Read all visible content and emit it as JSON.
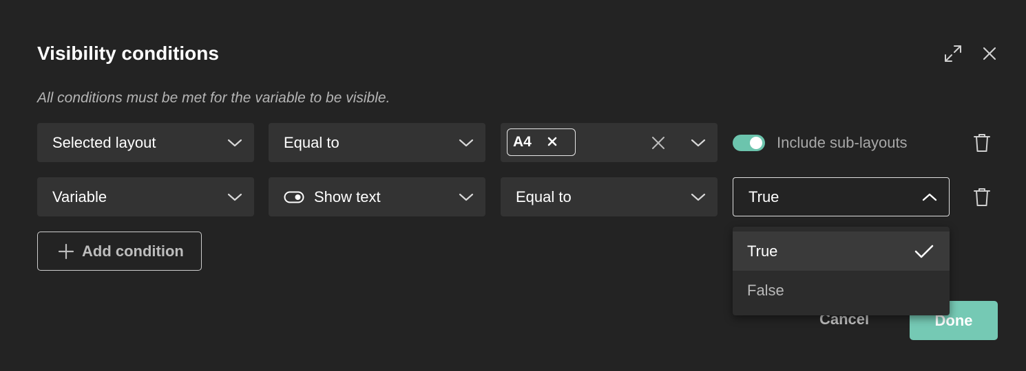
{
  "dialog": {
    "title": "Visibility conditions",
    "subtitle": "All conditions must be met for the variable to be visible.",
    "icons": {
      "expand": "expand-arrows-icon",
      "close": "close-icon"
    }
  },
  "rows": [
    {
      "field": "Selected layout",
      "operator": "Equal to",
      "value_chip": "A4",
      "include_sublayouts": {
        "label": "Include sub-layouts",
        "enabled": true
      }
    },
    {
      "field": "Variable",
      "variable": "Show text",
      "variable_icon": "toggle-icon",
      "operator": "Equal to",
      "value": "True"
    }
  ],
  "dropdown": {
    "options": [
      "True",
      "False"
    ],
    "selected": "True"
  },
  "actions": {
    "add_condition": "Add condition",
    "cancel": "Cancel",
    "done": "Done"
  },
  "colors": {
    "background": "#232323",
    "field": "#333333",
    "accent": "#75c9b4",
    "toggle_on": "#6cc4ad"
  }
}
